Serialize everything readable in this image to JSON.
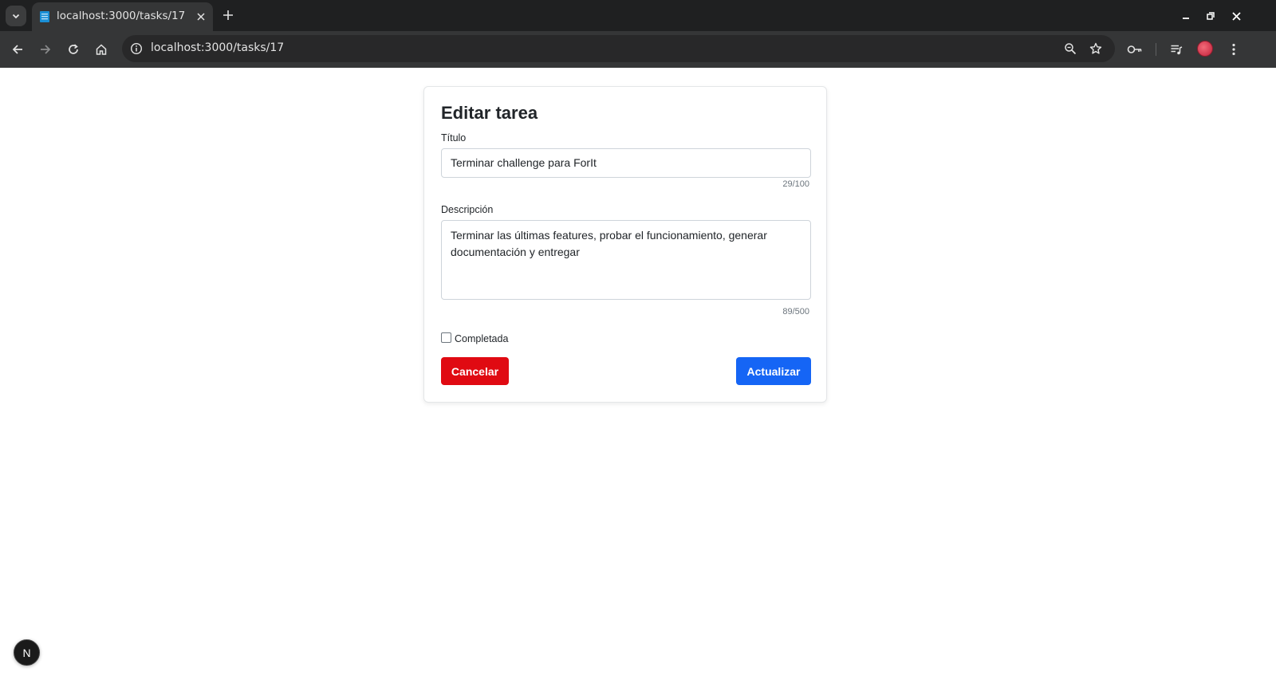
{
  "browser": {
    "tab_title": "localhost:3000/tasks/17",
    "url": "localhost:3000/tasks/17",
    "icons": {
      "tab_search": "chevron-down-icon",
      "favicon": "favicon-icon",
      "tab_close": "close-icon",
      "new_tab": "plus-icon",
      "minimize": "minimize-icon",
      "restore": "restore-icon",
      "window_close": "close-icon",
      "back": "back-arrow-icon",
      "forward": "forward-arrow-icon",
      "reload": "reload-icon",
      "home": "home-icon",
      "site_info": "info-icon",
      "zoom": "zoom-icon",
      "bookmark": "star-icon",
      "passwords": "key-icon",
      "media": "media-control-icon",
      "profile": "avatar",
      "menu": "kebab-menu-icon"
    }
  },
  "form": {
    "heading": "Editar tarea",
    "title_label": "Título",
    "title_value": "Terminar challenge para ForIt",
    "title_counter": "29/100",
    "description_label": "Descripción",
    "description_value": "Terminar las últimas features, probar el funcionamiento, generar documentación y entregar",
    "description_counter": "89/500",
    "completed_label": "Completada",
    "completed_checked": false,
    "cancel_label": "Cancelar",
    "update_label": "Actualizar",
    "colors": {
      "cancel": "#e00a12",
      "update": "#1565f5"
    }
  },
  "dev_badge": {
    "label": "N"
  }
}
